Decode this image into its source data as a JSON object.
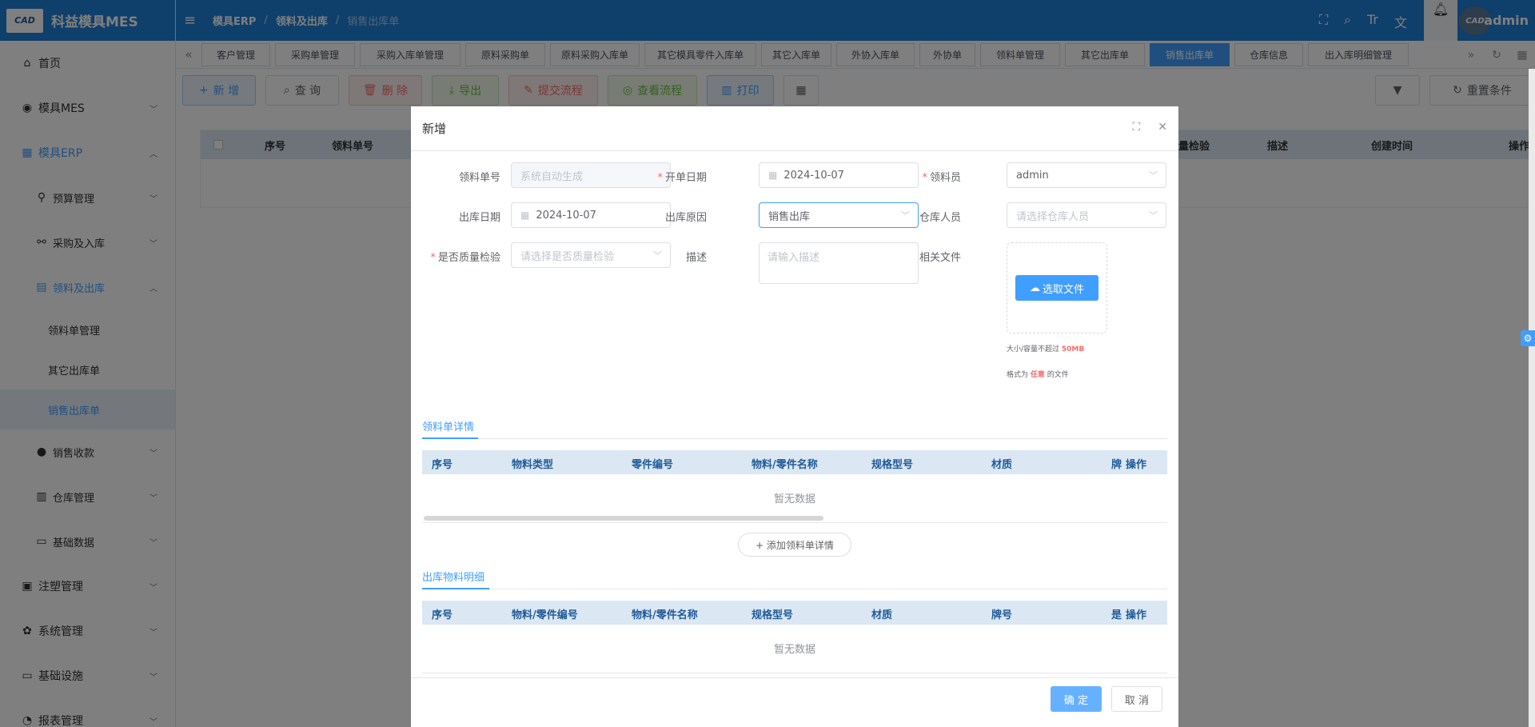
{
  "app": {
    "logo_text": "CAD",
    "title": "科益模具MES"
  },
  "sidebar": {
    "items": [
      {
        "icon": "home-icon",
        "glyph": "⌂",
        "label": "首页"
      },
      {
        "icon": "camera-icon",
        "glyph": "◉",
        "label": "模具MES"
      },
      {
        "icon": "erp-icon",
        "glyph": "▦",
        "label": "模具ERP"
      },
      {
        "icon": "budget-icon",
        "glyph": "⚲",
        "label": "预算管理"
      },
      {
        "icon": "purchase-icon",
        "glyph": "⚯",
        "label": "采购及入库"
      },
      {
        "icon": "material-icon",
        "glyph": "▤",
        "label": "领料及出库"
      },
      {
        "label": "领料单管理"
      },
      {
        "label": "其它出库单"
      },
      {
        "label": "销售出库单"
      },
      {
        "icon": "user-icon",
        "glyph": "●",
        "label": "销售收款"
      },
      {
        "icon": "calendar-icon",
        "glyph": "▥",
        "label": "仓库管理"
      },
      {
        "icon": "card-icon",
        "glyph": "▭",
        "label": "基础数据"
      },
      {
        "icon": "register-icon",
        "glyph": "▣",
        "label": "注塑管理"
      },
      {
        "icon": "settings-icon",
        "glyph": "✿",
        "label": "系统管理"
      },
      {
        "icon": "monitor-icon",
        "glyph": "▭",
        "label": "基础设施"
      },
      {
        "icon": "report-icon",
        "glyph": "◔",
        "label": "报表管理"
      }
    ]
  },
  "header": {
    "breadcrumb": [
      "模具ERP",
      "领料及出库",
      "销售出库单"
    ],
    "user": "admin",
    "avatar_text": "CAD"
  },
  "tabs": [
    "客户管理",
    "采购单管理",
    "采购入库单管理",
    "原料采购单",
    "原料采购入库单",
    "其它模具零件入库单",
    "其它入库单",
    "外协入库单",
    "外协单",
    "领料单管理",
    "其它出库单",
    "销售出库单",
    "仓库信息",
    "出入库明细管理"
  ],
  "tabs_active": "销售出库单",
  "toolbar": {
    "new": "新 增",
    "query": "查 询",
    "delete": "删 除",
    "export": "导出",
    "submit": "提交流程",
    "view": "查看流程",
    "print": "打印",
    "reset": "重置条件"
  },
  "bg_table": {
    "headers": [
      "序号",
      "领料单号",
      "质量检验",
      "描述",
      "创建时间",
      "操作"
    ]
  },
  "dialog": {
    "title": "新增",
    "fields": {
      "order_no": {
        "label": "领料单号",
        "placeholder": "系统自动生成"
      },
      "open_date": {
        "label": "开单日期",
        "value": "2024-10-07"
      },
      "picker": {
        "label": "领料员",
        "value": "admin"
      },
      "out_date": {
        "label": "出库日期",
        "value": "2024-10-07"
      },
      "out_reason": {
        "label": "出库原因",
        "value": "销售出库"
      },
      "warehouse_person": {
        "label": "仓库人员",
        "placeholder": "请选择仓库人员"
      },
      "quality_check": {
        "label": "是否质量检验",
        "placeholder": "请选择是否质量检验"
      },
      "description": {
        "label": "描述",
        "placeholder": "请输入描述"
      },
      "files": {
        "label": "相关文件",
        "button": "选取文件"
      }
    },
    "upload_tip1_prefix": "大小/容量不超过 ",
    "upload_tip1_value": "50MB",
    "upload_tip2_prefix": "格式为 ",
    "upload_tip2_value": "任意",
    "upload_tip2_suffix": " 的文件",
    "section1": {
      "title": "领料单详情",
      "headers": [
        "序号",
        "物料类型",
        "零件编号",
        "物料/零件名称",
        "规格型号",
        "材质",
        "牌",
        "操作"
      ],
      "empty": "暂无数据",
      "add_button": "+ 添加领料单详情"
    },
    "section2": {
      "title": "出库物料明细",
      "headers": [
        "序号",
        "物料/零件编号",
        "物料/零件名称",
        "规格型号",
        "材质",
        "牌号",
        "是",
        "操作"
      ],
      "empty": "暂无数据"
    },
    "confirm": "确 定",
    "cancel": "取 消"
  }
}
